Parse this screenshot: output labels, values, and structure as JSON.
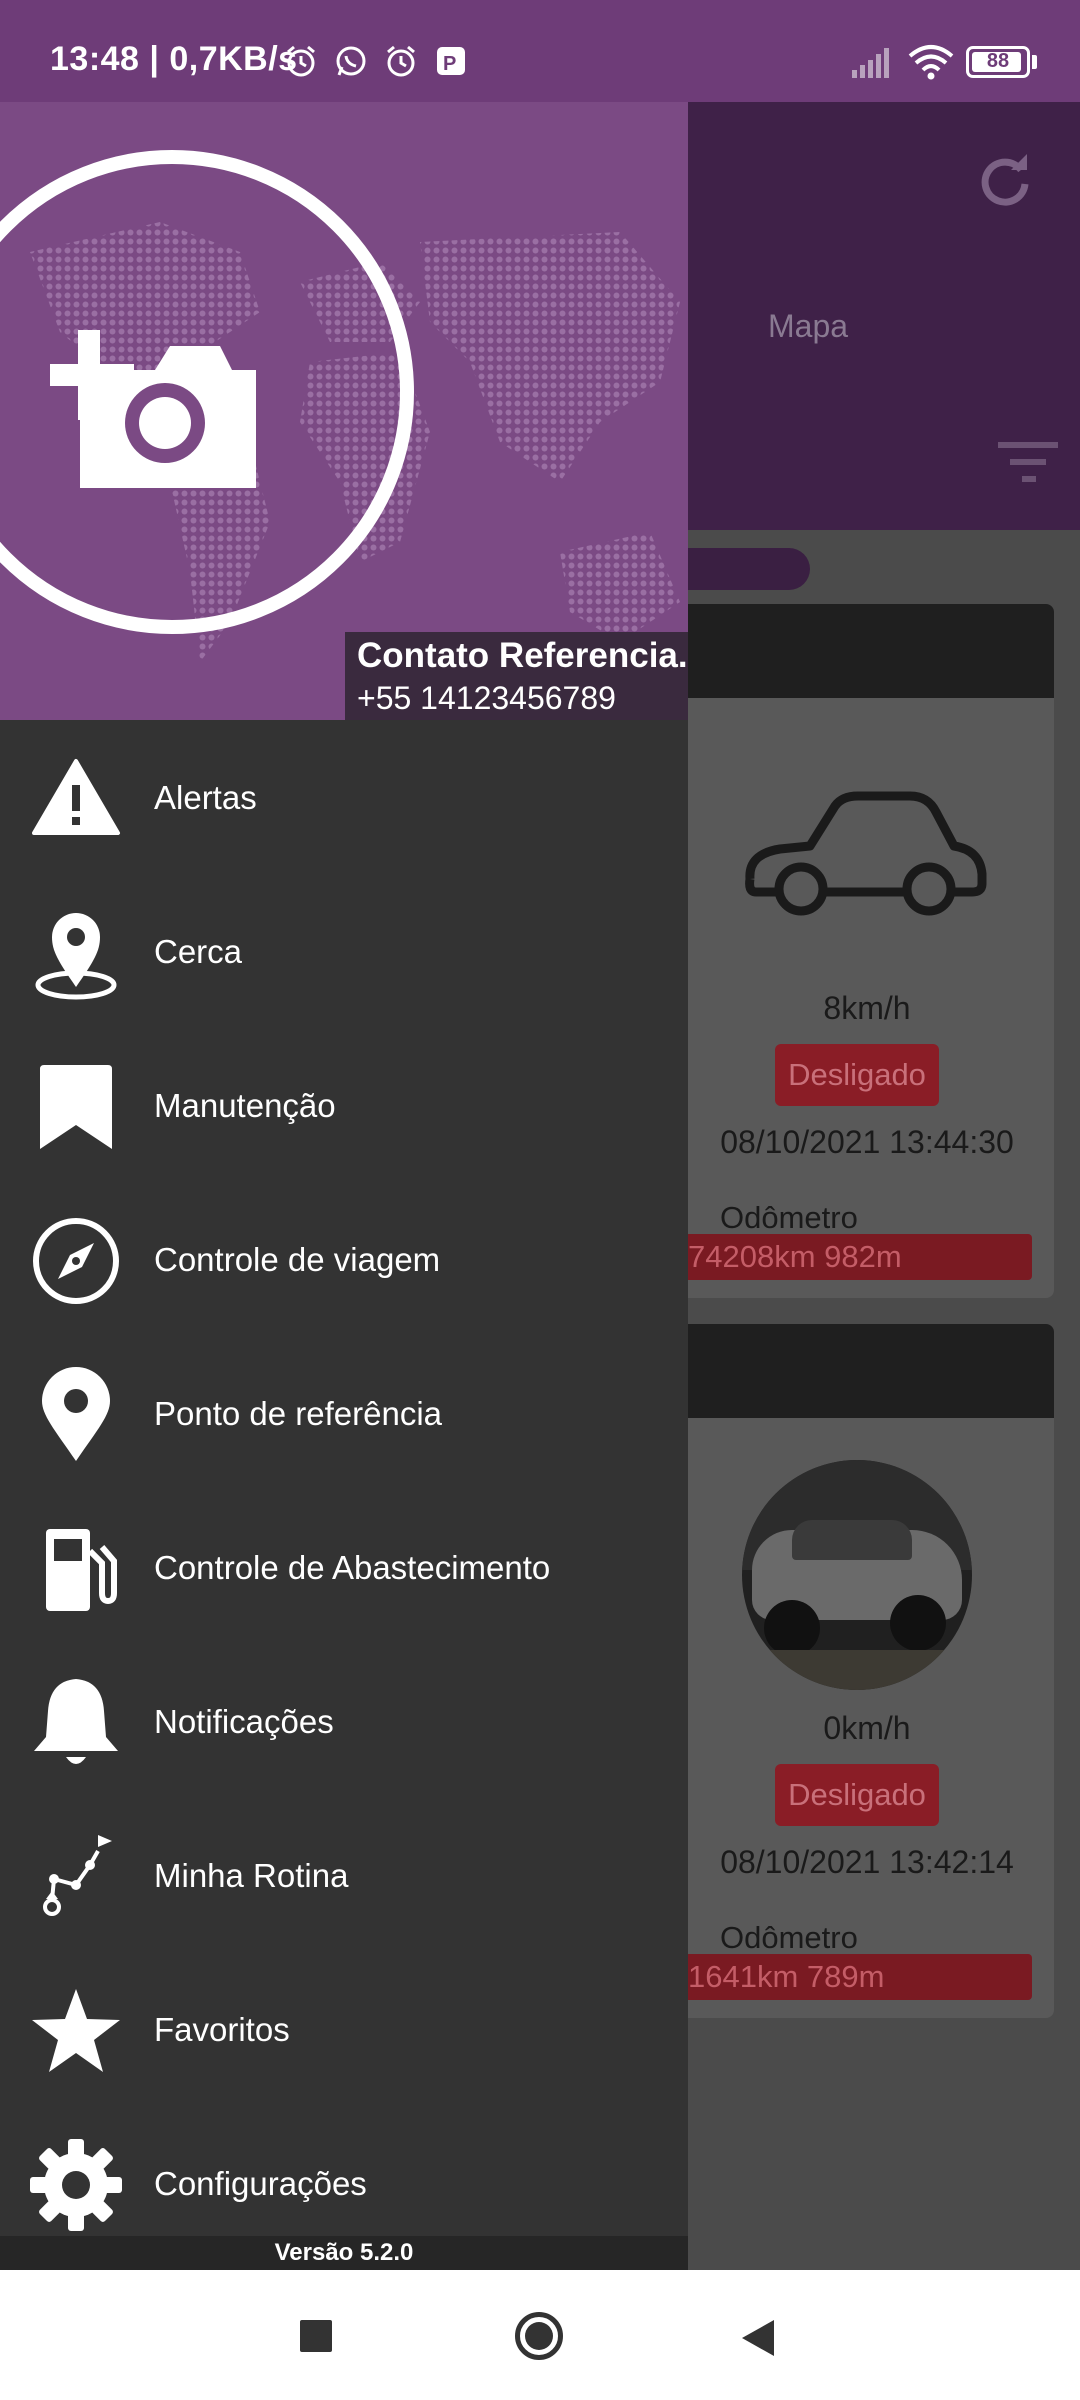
{
  "status_bar": {
    "text": "13:48 | 0,7KB/s",
    "battery": "88",
    "icons": [
      "alarm-icon",
      "whatsapp-icon",
      "alarm-icon",
      "parking-icon",
      "signal-icon",
      "wifi-icon",
      "battery-icon"
    ]
  },
  "background_app": {
    "tab_mapa": "Mapa",
    "vehicles": [
      {
        "speed": "8km/h",
        "status": "Desligado",
        "datetime": "08/10/2021 13:44:30",
        "odometer_label": "Odômetro",
        "odometer_value": "74208km 982m",
        "icon": "car-outline-icon"
      },
      {
        "speed": "0km/h",
        "status": "Desligado",
        "datetime": "08/10/2021 13:42:14",
        "odometer_label": "Odômetro",
        "odometer_value": "1641km 789m",
        "icon": "vehicle-photo"
      }
    ]
  },
  "drawer": {
    "contact_name": "Contato Referencia...",
    "contact_phone": "+55 14123456789",
    "items": [
      {
        "label": "Alertas",
        "icon": "warning-icon"
      },
      {
        "label": "Cerca",
        "icon": "geofence-pin-icon"
      },
      {
        "label": "Manutenção",
        "icon": "bookmark-icon"
      },
      {
        "label": "Controle de viagem",
        "icon": "compass-icon"
      },
      {
        "label": "Ponto de referência",
        "icon": "location-pin-icon"
      },
      {
        "label": "Controle de Abastecimento",
        "icon": "fuel-pump-icon"
      },
      {
        "label": "Notificações",
        "icon": "bell-icon"
      },
      {
        "label": "Minha Rotina",
        "icon": "route-icon"
      },
      {
        "label": "Favoritos",
        "icon": "star-icon"
      },
      {
        "label": "Configurações",
        "icon": "gear-icon"
      }
    ],
    "version": "Versão 5.2.0"
  },
  "colors": {
    "status_bar": "#6e3c78",
    "drawer_header": "#7b4a84",
    "drawer_bg": "#333333",
    "status_off": "#8a1d26"
  }
}
